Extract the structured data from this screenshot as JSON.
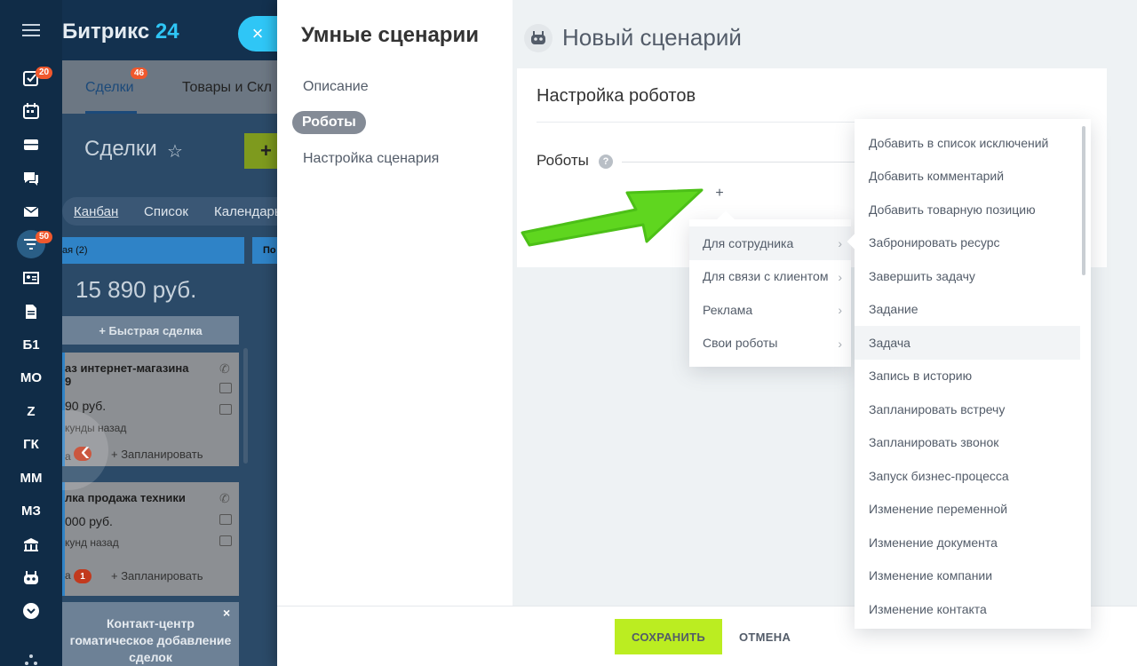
{
  "rail": {
    "badges": {
      "tasks": "20",
      "filter": "50"
    },
    "text_items": [
      "Б1",
      "МО",
      "Z",
      "ГК",
      "ММ",
      "МЗ"
    ]
  },
  "background": {
    "logo_main": "Битрикс",
    "logo_num": "24",
    "tabs": [
      {
        "label": "Сделки",
        "badge": "46"
      },
      {
        "label": "Товары и Скл"
      }
    ],
    "page_title": "Сделки",
    "view_tabs": [
      "Канбан",
      "Список",
      "Календарь"
    ],
    "stage_label": "ая",
    "stage_count": "(2)",
    "stage2_label": "По",
    "sum": "15 890 руб.",
    "quick_deal": "+ Быстрая сделка",
    "cards": [
      {
        "title": "аз интернет-магазина",
        "title2": "9",
        "price": "90 руб.",
        "meta": "кунды назад",
        "activity_label": "а",
        "activity_count": "",
        "action": "+ Запланировать"
      },
      {
        "title": "лка продажа техники",
        "title2": "",
        "price": "000 руб.",
        "meta": "кунд назад",
        "activity_label": "а",
        "activity_count": "1",
        "action": "+ Запланировать"
      }
    ],
    "contact_center_line1": "Контакт-центр",
    "contact_center_line2": "гоматическое добавление",
    "contact_center_line3": "сделок",
    "close_glyph": "×"
  },
  "panel": {
    "title": "Умные сценарии",
    "nav": [
      {
        "label": "Описание",
        "active": false
      },
      {
        "label": "Роботы",
        "active": true
      },
      {
        "label": "Настройка сценария",
        "active": false
      }
    ],
    "scenario_title": "Новый сценарий",
    "card_title": "Настройка роботов",
    "robots_label": "Роботы",
    "help_glyph": "?",
    "plus_glyph": "+"
  },
  "category_menu": {
    "items": [
      {
        "label": "Для сотрудника",
        "hover": true
      },
      {
        "label": "Для связи с клиентом",
        "hover": false
      },
      {
        "label": "Реклама",
        "hover": false
      },
      {
        "label": "Свои роботы",
        "hover": false
      }
    ],
    "chevron": "›"
  },
  "robot_list": {
    "items": [
      "Добавить в список исключений",
      "Добавить комментарий",
      "Добавить товарную позицию",
      "Забронировать ресурс",
      "Завершить задачу",
      "Задание",
      "Задача",
      "Запись в историю",
      "Запланировать встречу",
      "Запланировать звонок",
      "Запуск бизнес-процесса",
      "Изменение переменной",
      "Изменение документа",
      "Изменение компании",
      "Изменение контакта"
    ],
    "hover_index": 6
  },
  "buttons": {
    "save": "СОХРАНИТЬ",
    "cancel": "ОТМЕНА"
  },
  "colors": {
    "accent_green": "#bbed21",
    "arrow_green": "#5fd61f",
    "badge_orange": "#f0582d",
    "bitrix_blue": "#2fc6f6"
  }
}
